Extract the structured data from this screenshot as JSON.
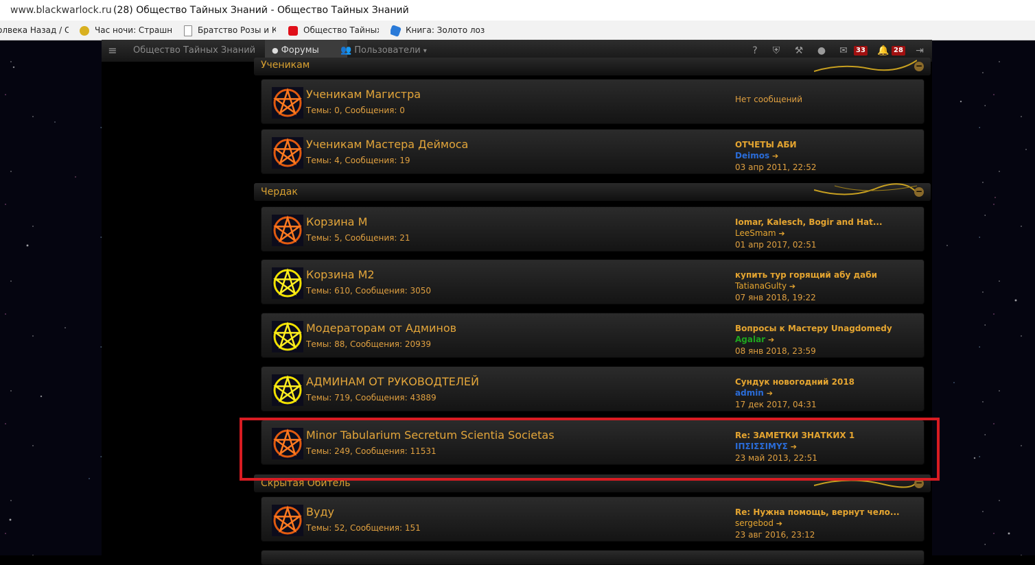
{
  "browser": {
    "url": "www.blackwarlock.ru",
    "title": "(28) Общество Тайных Знаний - Общество Тайных Знаний",
    "bookmarks": [
      {
        "label": "олвека Назад / С"
      },
      {
        "label": "Час ночи: Страшн"
      },
      {
        "label": "Братство Розы и К"
      },
      {
        "label": "Общество Тайных"
      },
      {
        "label": "Книга: Золото лоз"
      }
    ]
  },
  "navbar": {
    "site": "Общество Тайных Знаний",
    "forums": "Форумы",
    "users": "Пользователи",
    "messages_count": "33",
    "notifications_count": "28"
  },
  "categories": [
    {
      "title": "Ученикам"
    },
    {
      "title": "Чердак"
    },
    {
      "title": "Скрытая Обитель"
    }
  ],
  "forums": [
    {
      "name": "Ученикам Магистра",
      "stats": "Темы: 0, Сообщения: 0",
      "icon": "pentagram-orange",
      "last_empty": "Нет сообщений"
    },
    {
      "name": "Ученикам Мастера Деймоса",
      "stats": "Темы: 4, Сообщения: 19",
      "icon": "pentagram-orange",
      "last_title": "ОТЧЕТЫ АБИ",
      "last_user": "Deimos",
      "last_date": "03 апр 2011, 22:52"
    },
    {
      "name": "Корзина М",
      "stats": "Темы: 5, Сообщения: 21",
      "icon": "pentagram-orange",
      "last_title": "Iomar, Kalesch, Bogir and Hat...",
      "last_user": "LeeSmam",
      "last_date": "01 апр 2017, 02:51"
    },
    {
      "name": "Корзина М2",
      "stats": "Темы: 610, Сообщения: 3050",
      "icon": "pentagram-yellow",
      "last_title": "купить тур горящий абу даби",
      "last_user": "TatianaGulty",
      "last_date": "07 янв 2018, 19:22"
    },
    {
      "name": "Модераторам от Админов",
      "stats": "Темы: 88, Сообщения: 20939",
      "icon": "pentagram-yellow",
      "last_title": "Вопросы к Мастеру Unagdomedy",
      "last_user": "Agalar",
      "last_date": "08 янв 2018, 23:59"
    },
    {
      "name": "АДМИНАМ ОТ РУКОВОДТЕЛЕЙ",
      "stats": "Темы: 719, Сообщения: 43889",
      "icon": "pentagram-yellow",
      "last_title": "Сундук новогодний 2018",
      "last_user": "admin",
      "last_date": "17 дек 2017, 04:31"
    },
    {
      "name": "Minor Tabularium Secretum Scientia Societas",
      "stats": "Темы: 249, Сообщения: 11531",
      "icon": "pentagram-orange",
      "last_title": "Re: ЗАМЕТКИ ЗНАТКИХ 1",
      "last_user": "ΙΠΣΙΣΣΙΜΥΣ",
      "last_date": "23 май 2013, 22:51"
    },
    {
      "name": "Вуду",
      "stats": "Темы: 52, Сообщения: 151",
      "icon": "pentagram-orange",
      "last_title": "Re: Нужна помощь, вернут чело...",
      "last_user": "sergebod",
      "last_date": "23 авг 2016, 23:12"
    }
  ],
  "colors": {
    "accent": "#e4a63a",
    "highlight": "#d81c22",
    "user_blue": "#2a6cd8",
    "user_green": "#1ea51e"
  }
}
